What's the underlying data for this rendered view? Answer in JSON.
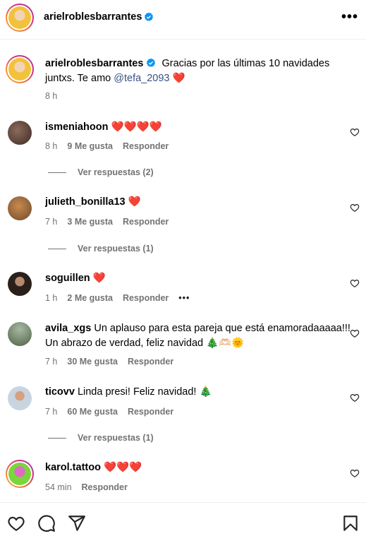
{
  "header": {
    "username": "arielroblesbarrantes",
    "more_icon": "more-horizontal-icon"
  },
  "caption": {
    "username": "arielroblesbarrantes",
    "text_before": "Gracias por las últimas 10 navidades juntxs. Te amo ",
    "mention": "@tefa_2093",
    "emoji": "❤️",
    "time": "8 h"
  },
  "comments": [
    {
      "username": "ismeniahoon",
      "text": "",
      "emoji": "❤️❤️❤️❤️",
      "time": "8 h",
      "likes": "9 Me gusta",
      "reply": "Responder",
      "view_replies": "Ver respuestas (2)"
    },
    {
      "username": "julieth_bonilla13",
      "text": "",
      "emoji": "❤️",
      "time": "7 h",
      "likes": "3 Me gusta",
      "reply": "Responder",
      "view_replies": "Ver respuestas (1)"
    },
    {
      "username": "soguillen",
      "text": "",
      "emoji": "❤️",
      "time": "1 h",
      "likes": "2 Me gusta",
      "reply": "Responder",
      "more": "•••"
    },
    {
      "username": "avila_xgs",
      "text": "Un aplauso para esta pareja que está enamoradaaaaa!!! Un abrazo de verdad, feliz navidad ",
      "emoji": "🎄🫶🏻🌞",
      "time": "7 h",
      "likes": "30 Me gusta",
      "reply": "Responder"
    },
    {
      "username": "ticovv",
      "text": "Linda presi! Feliz navidad! ",
      "emoji": "🎄",
      "time": "7 h",
      "likes": "60 Me gusta",
      "reply": "Responder",
      "view_replies": "Ver respuestas (1)"
    },
    {
      "username": "karol.tattoo",
      "text": "",
      "emoji": "❤️❤️❤️",
      "time": "54 min",
      "reply": "Responder"
    }
  ],
  "action_bar": {
    "icons": [
      "heart-icon",
      "comment-icon",
      "share-icon",
      "bookmark-icon"
    ]
  },
  "colors": {
    "verified": "#0095f6",
    "secondary_text": "#737373",
    "mention": "#385185",
    "heart_red": "#ed1c24"
  }
}
